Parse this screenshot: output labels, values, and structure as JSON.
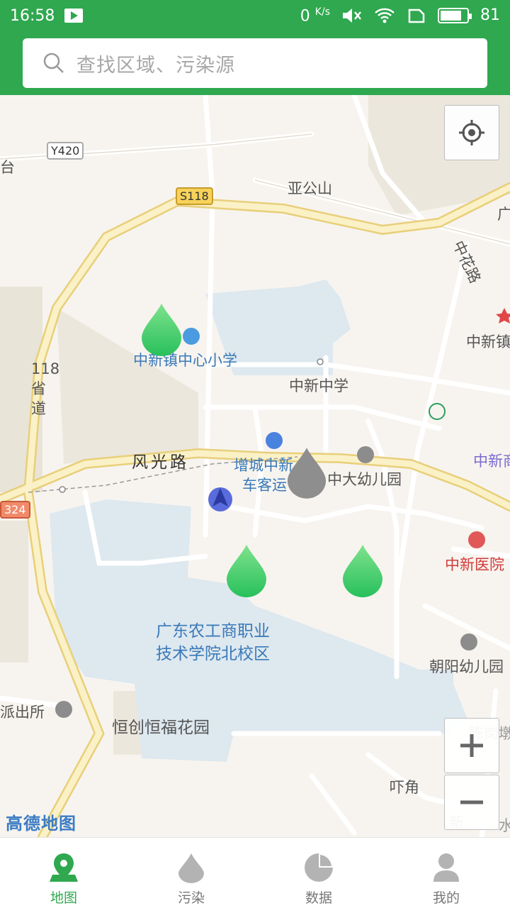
{
  "status_bar": {
    "time": "16:58",
    "net_speed": "0",
    "net_unit": "K/s",
    "battery": "81"
  },
  "search": {
    "placeholder": "查找区域、污染源"
  },
  "map": {
    "labels": {
      "y420": "Y420",
      "s118": "S118",
      "tai": "台",
      "yagong": "亚公山",
      "guang": "广",
      "zhonghua_road": "中花路",
      "zhongxinzhen": "中新镇",
      "school_primary": "中新镇中心小学",
      "school_middle": "中新中学",
      "provincial_road": "118省道",
      "fengguang_road": "风光路",
      "bus_station_1": "增城中新",
      "bus_station_2": "车客运",
      "kindergarten": "中大幼儿园",
      "zhongxin_right": "中新商",
      "hospital": "中新医院",
      "college_1": "广东农工商职业",
      "college_2": "技术学院北校区",
      "chaoyang": "朝阳幼儿园",
      "police": "派出所",
      "hengchuang": "恒创恒福花园",
      "chengang": "陈岗墩",
      "pijiao": "吓角",
      "xin": "新",
      "shui": "水",
      "r324": "324",
      "logo": "高德地图"
    },
    "markers": [
      {
        "name": "green-drop-1",
        "status": "green"
      },
      {
        "name": "grey-drop-1",
        "status": "grey"
      },
      {
        "name": "green-drop-2",
        "status": "green"
      },
      {
        "name": "green-drop-3",
        "status": "green"
      }
    ],
    "colors": {
      "green": "#3ecf6a",
      "grey": "#8e8e8e"
    }
  },
  "nav": [
    {
      "label": "地图",
      "icon": "map-pin-icon",
      "active": true
    },
    {
      "label": "污染",
      "icon": "drop-icon",
      "active": false
    },
    {
      "label": "数据",
      "icon": "pie-chart-icon",
      "active": false
    },
    {
      "label": "我的",
      "icon": "user-icon",
      "active": false
    }
  ],
  "accent": "#2fa84f"
}
